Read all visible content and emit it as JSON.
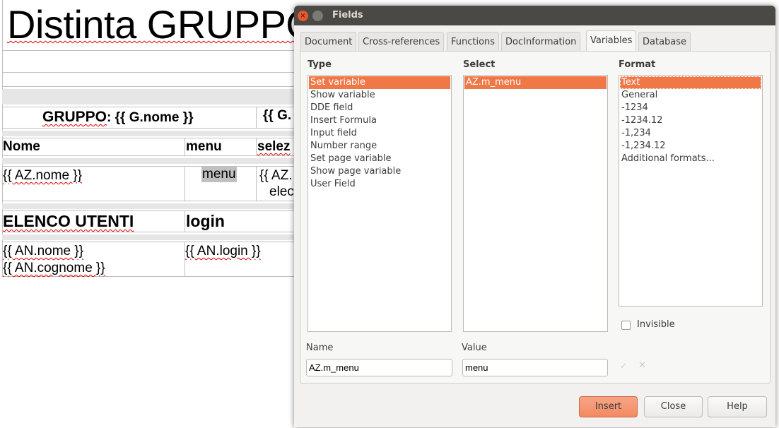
{
  "document": {
    "title": "Distinta GRUPPO",
    "gruppo_label": "GRUPPO",
    "gruppo_value": ": {{ G.nome }}",
    "gruppo_right": "{{ G.",
    "headers": [
      "Nome",
      "menu",
      "selez"
    ],
    "row": {
      "nome": "{{ AZ.nome }}",
      "menu_field": "menu",
      "selez_line1": "{{ AZ.",
      "selez_line2": "elec"
    },
    "users_headers": [
      "ELENCO UTENTI",
      "login"
    ],
    "users_row": {
      "nome": "{{ AN.nome }}",
      "cognome": "{{ AN.cognome }}",
      "login": "{{ AN.login }}"
    }
  },
  "dialog": {
    "title": "Fields",
    "tabs": [
      "Document",
      "Cross-references",
      "Functions",
      "DocInformation",
      "Variables",
      "Database"
    ],
    "active_tab": "Variables",
    "type_label": "Type",
    "type_items": [
      "Set variable",
      "Show variable",
      "DDE field",
      "Insert Formula",
      "Input field",
      "Number range",
      "Set page variable",
      "Show page variable",
      "User Field"
    ],
    "type_selected": "Set variable",
    "select_label": "Select",
    "select_items": [
      "AZ.m_menu"
    ],
    "format_label": "Format",
    "format_items": [
      "Text",
      "General",
      "-1234",
      "-1234.12",
      "-1,234",
      "-1,234.12",
      "Additional formats..."
    ],
    "format_selected": "Text",
    "invisible_label": "Invisible",
    "invisible_checked": false,
    "name_label": "Name",
    "name_value": "AZ.m_menu",
    "value_label": "Value",
    "value_value": "menu",
    "buttons": {
      "insert": "Insert",
      "close": "Close",
      "help": "Help"
    },
    "accent_color": "#f07746"
  }
}
